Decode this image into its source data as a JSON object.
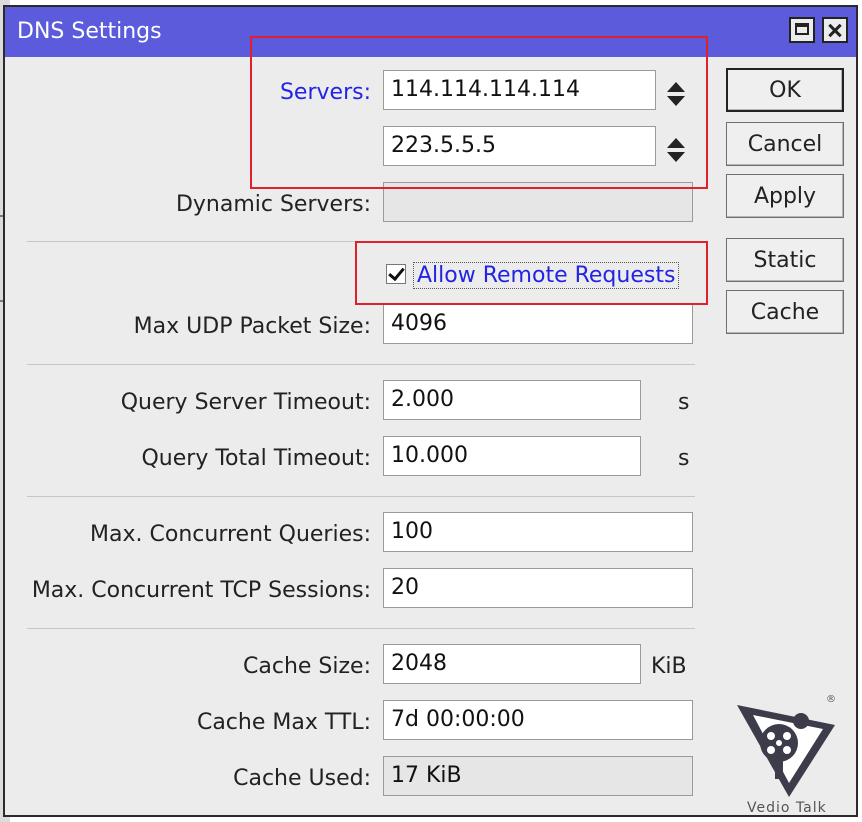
{
  "window": {
    "title": "DNS Settings"
  },
  "servers": {
    "label": "Servers:",
    "values": [
      "114.114.114.114",
      "223.5.5.5"
    ]
  },
  "dynamic_servers": {
    "label": "Dynamic Servers:",
    "value": ""
  },
  "allow_remote_requests": {
    "label": "Allow Remote Requests",
    "checked": true
  },
  "max_udp_packet_size": {
    "label": "Max UDP Packet Size:",
    "value": "4096"
  },
  "query_server_timeout": {
    "label": "Query Server Timeout:",
    "value": "2.000",
    "unit": "s"
  },
  "query_total_timeout": {
    "label": "Query Total Timeout:",
    "value": "10.000",
    "unit": "s"
  },
  "max_concurrent_queries": {
    "label": "Max. Concurrent Queries:",
    "value": "100"
  },
  "max_concurrent_tcp_sessions": {
    "label": "Max. Concurrent TCP Sessions:",
    "value": "20"
  },
  "cache_size": {
    "label": "Cache Size:",
    "value": "2048",
    "unit": "KiB"
  },
  "cache_max_ttl": {
    "label": "Cache Max TTL:",
    "value": "7d 00:00:00"
  },
  "cache_used": {
    "label": "Cache Used:",
    "value": "17 KiB"
  },
  "buttons": {
    "ok": "OK",
    "cancel": "Cancel",
    "apply": "Apply",
    "static": "Static",
    "cache": "Cache"
  },
  "watermark": {
    "text": "Vedio Talk",
    "mark": "®"
  },
  "colors": {
    "titlebar": "#5b5bdb",
    "highlight": "#e0202a",
    "link_blue": "#2323e6"
  }
}
